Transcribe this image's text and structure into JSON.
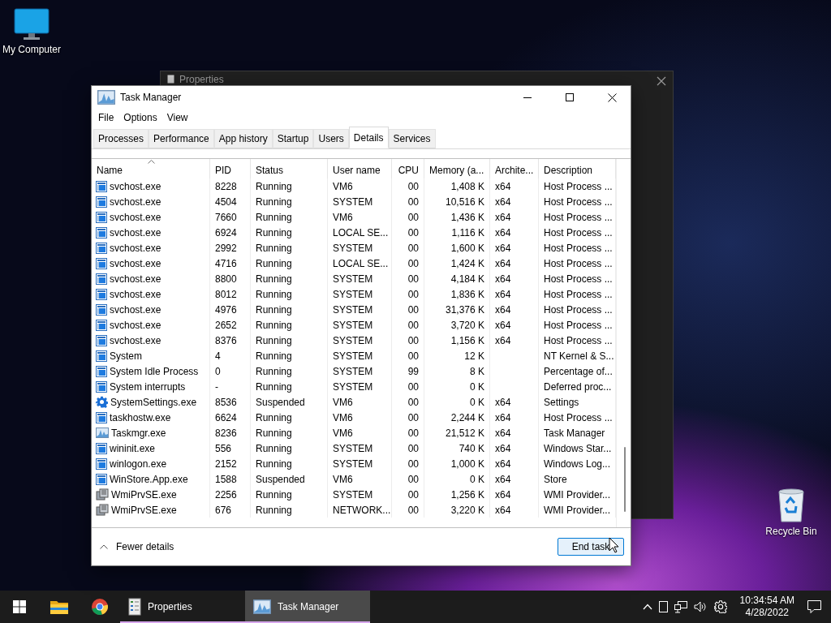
{
  "desktop_icons": [
    {
      "kind": "computer",
      "label": "My Computer"
    },
    {
      "kind": "recycle",
      "label": "Recycle Bin"
    }
  ],
  "background_window": {
    "title": "Properties"
  },
  "window": {
    "title": "Task Manager"
  },
  "menu": [
    "File",
    "Options",
    "View"
  ],
  "tabs": [
    {
      "label": "Processes",
      "selected": false
    },
    {
      "label": "Performance",
      "selected": false
    },
    {
      "label": "App history",
      "selected": false
    },
    {
      "label": "Startup",
      "selected": false
    },
    {
      "label": "Users",
      "selected": false
    },
    {
      "label": "Details",
      "selected": true
    },
    {
      "label": "Services",
      "selected": false
    }
  ],
  "table": {
    "columns": [
      {
        "label": "Name",
        "sorted": true
      },
      {
        "label": "PID",
        "sorted": false
      },
      {
        "label": "Status",
        "sorted": false
      },
      {
        "label": "User name",
        "sorted": false
      },
      {
        "label": "CPU",
        "sorted": false
      },
      {
        "label": "Memory (a...",
        "sorted": false
      },
      {
        "label": "Archite...",
        "sorted": false
      },
      {
        "label": "Description",
        "sorted": false
      }
    ],
    "rows": [
      {
        "kind": "service",
        "cells": [
          "svchost.exe",
          "8228",
          "Running",
          "VM6",
          "00",
          "1,408 K",
          "x64",
          "Host Process ..."
        ]
      },
      {
        "kind": "service",
        "cells": [
          "svchost.exe",
          "4504",
          "Running",
          "SYSTEM",
          "00",
          "10,516 K",
          "x64",
          "Host Process ..."
        ]
      },
      {
        "kind": "service",
        "cells": [
          "svchost.exe",
          "7660",
          "Running",
          "VM6",
          "00",
          "1,436 K",
          "x64",
          "Host Process ..."
        ]
      },
      {
        "kind": "service",
        "cells": [
          "svchost.exe",
          "6924",
          "Running",
          "LOCAL SE...",
          "00",
          "1,116 K",
          "x64",
          "Host Process ..."
        ]
      },
      {
        "kind": "service",
        "cells": [
          "svchost.exe",
          "2992",
          "Running",
          "SYSTEM",
          "00",
          "1,600 K",
          "x64",
          "Host Process ..."
        ]
      },
      {
        "kind": "service",
        "cells": [
          "svchost.exe",
          "4716",
          "Running",
          "LOCAL SE...",
          "00",
          "1,424 K",
          "x64",
          "Host Process ..."
        ]
      },
      {
        "kind": "service",
        "cells": [
          "svchost.exe",
          "8800",
          "Running",
          "SYSTEM",
          "00",
          "4,184 K",
          "x64",
          "Host Process ..."
        ]
      },
      {
        "kind": "service",
        "cells": [
          "svchost.exe",
          "8012",
          "Running",
          "SYSTEM",
          "00",
          "1,836 K",
          "x64",
          "Host Process ..."
        ]
      },
      {
        "kind": "service",
        "cells": [
          "svchost.exe",
          "4976",
          "Running",
          "SYSTEM",
          "00",
          "31,376 K",
          "x64",
          "Host Process ..."
        ]
      },
      {
        "kind": "service",
        "cells": [
          "svchost.exe",
          "2652",
          "Running",
          "SYSTEM",
          "00",
          "3,720 K",
          "x64",
          "Host Process ..."
        ]
      },
      {
        "kind": "service",
        "cells": [
          "svchost.exe",
          "8376",
          "Running",
          "SYSTEM",
          "00",
          "1,156 K",
          "x64",
          "Host Process ..."
        ]
      },
      {
        "kind": "service",
        "cells": [
          "System",
          "4",
          "Running",
          "SYSTEM",
          "00",
          "12 K",
          "",
          "NT Kernel & S..."
        ]
      },
      {
        "kind": "service",
        "cells": [
          "System Idle Process",
          "0",
          "Running",
          "SYSTEM",
          "99",
          "8 K",
          "",
          "Percentage of..."
        ]
      },
      {
        "kind": "service",
        "cells": [
          "System interrupts",
          "-",
          "Running",
          "SYSTEM",
          "00",
          "0 K",
          "",
          "Deferred proc..."
        ]
      },
      {
        "kind": "gear",
        "cells": [
          "SystemSettings.exe",
          "8536",
          "Suspended",
          "VM6",
          "00",
          "0 K",
          "x64",
          "Settings"
        ]
      },
      {
        "kind": "service",
        "cells": [
          "taskhostw.exe",
          "6624",
          "Running",
          "VM6",
          "00",
          "2,244 K",
          "x64",
          "Host Process ..."
        ]
      },
      {
        "kind": "chart",
        "cells": [
          "Taskmgr.exe",
          "8236",
          "Running",
          "VM6",
          "00",
          "21,512 K",
          "x64",
          "Task Manager"
        ]
      },
      {
        "kind": "service",
        "cells": [
          "wininit.exe",
          "556",
          "Running",
          "SYSTEM",
          "00",
          "740 K",
          "x64",
          "Windows Star..."
        ]
      },
      {
        "kind": "service",
        "cells": [
          "winlogon.exe",
          "2152",
          "Running",
          "SYSTEM",
          "00",
          "1,000 K",
          "x64",
          "Windows Log..."
        ]
      },
      {
        "kind": "service",
        "cells": [
          "WinStore.App.exe",
          "1588",
          "Suspended",
          "VM6",
          "00",
          "0 K",
          "x64",
          "Store"
        ]
      },
      {
        "kind": "wmi",
        "cells": [
          "WmiPrvSE.exe",
          "2256",
          "Running",
          "SYSTEM",
          "00",
          "1,256 K",
          "x64",
          "WMI Provider..."
        ]
      },
      {
        "kind": "wmi",
        "cells": [
          "WmiPrvSE.exe",
          "676",
          "Running",
          "NETWORK...",
          "00",
          "3,220 K",
          "x64",
          "WMI Provider..."
        ]
      }
    ]
  },
  "footer": {
    "toggle": "Fewer details",
    "button": "End task"
  },
  "taskbar": {
    "apps": [
      {
        "kind": "explorer",
        "selected": false
      },
      {
        "kind": "chrome",
        "selected": false
      },
      {
        "kind": "properties",
        "label": "Properties",
        "selected": false
      },
      {
        "kind": "taskmgr",
        "label": "Task Manager",
        "selected": true
      }
    ],
    "time": "10:34:54 AM",
    "date": "4/28/2022"
  }
}
